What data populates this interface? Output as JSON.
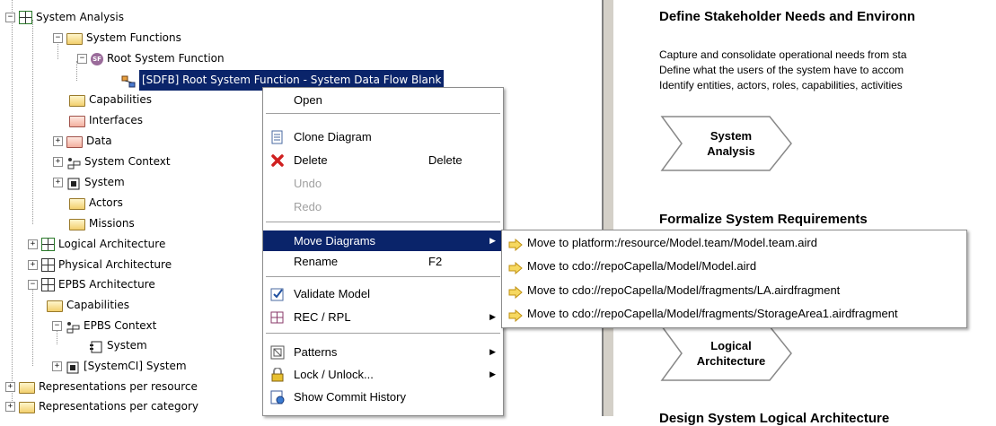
{
  "tree": {
    "items": [
      {
        "label": "System Analysis",
        "icon": "project-grid-icon",
        "exp": "−"
      },
      {
        "label": "System Functions",
        "icon": "folder-open-icon",
        "exp": "−"
      },
      {
        "label": "Root System Function",
        "icon": "system-function-icon",
        "exp": "−"
      },
      {
        "label": "[SDFB] Root System Function - System Data Flow Blank",
        "icon": "diagram-icon",
        "exp": ""
      },
      {
        "label": "Capabilities",
        "icon": "folder-icon",
        "exp": ""
      },
      {
        "label": "Interfaces",
        "icon": "folder-red-icon",
        "exp": ""
      },
      {
        "label": "Data",
        "icon": "folder-red-icon",
        "exp": "+"
      },
      {
        "label": "System Context",
        "icon": "context-icon",
        "exp": "+"
      },
      {
        "label": "System",
        "icon": "component-icon",
        "exp": "+"
      },
      {
        "label": "Actors",
        "icon": "folder-icon",
        "exp": ""
      },
      {
        "label": "Missions",
        "icon": "folder-icon",
        "exp": ""
      },
      {
        "label": "Logical Architecture",
        "icon": "project-grid-icon",
        "exp": "+"
      },
      {
        "label": "Physical Architecture",
        "icon": "grid-icon",
        "exp": "+"
      },
      {
        "label": "EPBS Architecture",
        "icon": "grid-icon",
        "exp": "−"
      },
      {
        "label": "Capabilities",
        "icon": "folder-icon",
        "exp": ""
      },
      {
        "label": "EPBS Context",
        "icon": "context-icon",
        "exp": "−"
      },
      {
        "label": "System",
        "icon": "component-icon",
        "exp": ""
      },
      {
        "label": "[SystemCI] System",
        "icon": "component-icon",
        "exp": "+"
      },
      {
        "label": "Representations per resource",
        "icon": "folder-icon",
        "exp": "+"
      },
      {
        "label": "Representations per category",
        "icon": "folder-icon",
        "exp": "+"
      }
    ]
  },
  "right": {
    "heading1": "Define Stakeholder Needs and Environn",
    "para1": [
      "Capture and consolidate operational needs from sta",
      "Define what the users of the system have to accom",
      "Identify entities, actors, roles, capabilities, activities"
    ],
    "box1": "System\nAnalysis",
    "heading2": "Formalize System Requirements",
    "box2": "Logical\nArchitecture",
    "heading3": "Design System Logical Architecture"
  },
  "context_menu": {
    "open": "Open",
    "clone": "Clone Diagram",
    "delete": "Delete",
    "delete_acc": "Delete",
    "undo": "Undo",
    "redo": "Redo",
    "move": "Move Diagrams",
    "rename": "Rename",
    "rename_acc": "F2",
    "validate": "Validate Model",
    "rec": "REC / RPL",
    "patterns": "Patterns",
    "lock": "Lock / Unlock...",
    "history": "Show Commit History"
  },
  "submenu": {
    "items": [
      "Move to platform:/resource/Model.team/Model.team.aird",
      "Move to cdo://repoCapella/Model/Model.aird",
      "Move to cdo://repoCapella/Model/fragments/LA.airdfragment",
      "Move to cdo://repoCapella/Model/fragments/StorageArea1.airdfragment"
    ]
  },
  "colors": {
    "selection": "#0a246a",
    "menu_border": "#8c8c8c",
    "delete_red": "#d02020",
    "arrow_yellow": "#f0c020"
  }
}
